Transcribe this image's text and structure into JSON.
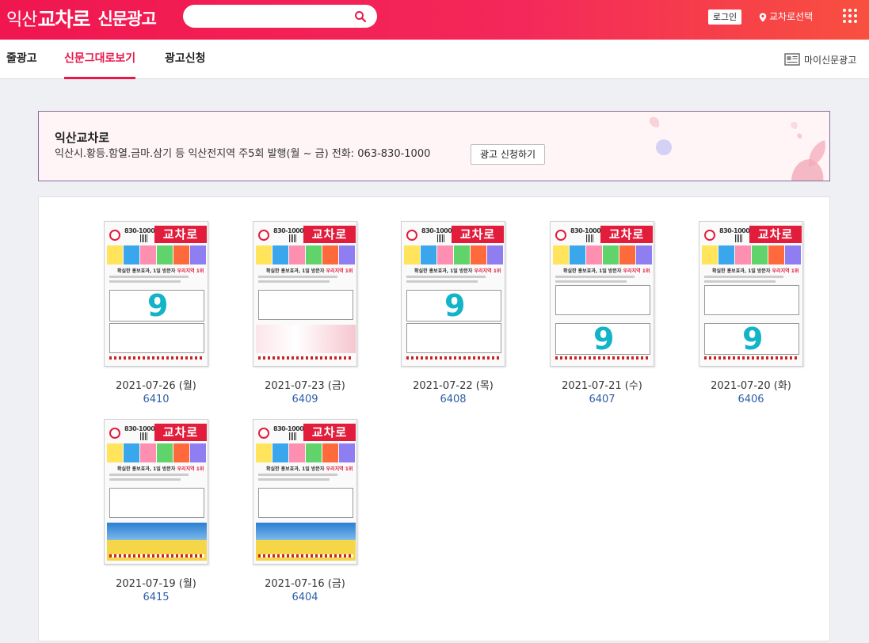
{
  "header": {
    "logo_region": "익산",
    "logo_brand": "교차로",
    "logo_section": "신문광고",
    "search_placeholder": "",
    "login_label": "로그인",
    "region_label": "교차로선택",
    "brand_color": "#f0164f"
  },
  "nav": {
    "tabs": [
      {
        "label": "줄광고",
        "active": false
      },
      {
        "label": "신문그대로보기",
        "active": true
      },
      {
        "label": "광고신청",
        "active": false
      }
    ],
    "my_paper_label": "마이신문광고"
  },
  "banner": {
    "title": "익산교차로",
    "description": "익산시.황등.함열.금마.삼기 등 익산전지역 주5회 발행(월 ~ 금) 전화: 063-830-1000",
    "apply_label": "광고 신청하기"
  },
  "papers": [
    {
      "date": "2021-07-26 (월)",
      "number": "6410",
      "layout": "nine"
    },
    {
      "date": "2021-07-23 (금)",
      "number": "6409",
      "layout": "promo"
    },
    {
      "date": "2021-07-22 (목)",
      "number": "6408",
      "layout": "nine"
    },
    {
      "date": "2021-07-21 (수)",
      "number": "6407",
      "layout": "nine-low"
    },
    {
      "date": "2021-07-20 (화)",
      "number": "6406",
      "layout": "nine-low"
    },
    {
      "date": "2021-07-19 (월)",
      "number": "6415",
      "layout": "drone"
    },
    {
      "date": "2021-07-16 (금)",
      "number": "6404",
      "layout": "drone"
    }
  ],
  "thumbnail_text": {
    "phone": "830-1000",
    "masthead": "교차로",
    "headline_a": "확실한 홍보효과, 1일 방문자 ",
    "headline_b": "우리지역 1위",
    "big_number": "9"
  }
}
